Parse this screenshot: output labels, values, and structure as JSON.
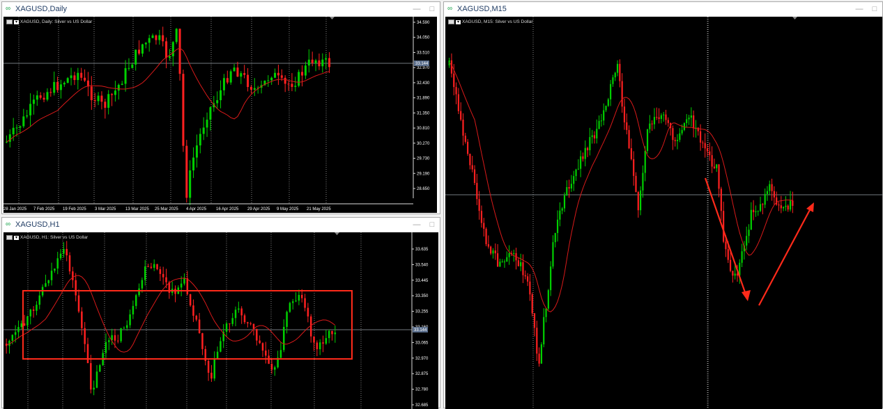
{
  "colors": {
    "bull": "#00d000",
    "bear": "#ff2020",
    "ma": "#d81a1a",
    "bg": "#000000",
    "grid": "#bbbbbb",
    "annotation": "#ff2a1a",
    "price_tag_bg": "#5a6e8c"
  },
  "windows": {
    "daily": {
      "title": "XAGUSD,Daily",
      "label": "XAGUSD, Daily:  Silver vs US Dollar",
      "price_levels": [
        "34.590",
        "34.050",
        "33.510",
        "32.970",
        "32.430",
        "31.890",
        "31.350",
        "30.810",
        "30.270",
        "29.730",
        "29.190",
        "28.650"
      ],
      "current_price": "33.144",
      "dates": [
        "28 Jan 2025",
        "7 Feb 2025",
        "19 Feb 2025",
        "3 Mar 2025",
        "13 Mar 2025",
        "25 Mar 2025",
        "4 Apr 2025",
        "16 Apr 2025",
        "29 Apr 2025",
        "9 May 2025",
        "21 May 2025"
      ]
    },
    "h1": {
      "title": "XAGUSD,H1",
      "label": "XAGUSD, H1:  Silver vs US Dollar",
      "price_levels": [
        "33.635",
        "33.540",
        "33.445",
        "33.350",
        "33.255",
        "33.160",
        "33.065",
        "32.970",
        "32.875",
        "32.780",
        "32.685"
      ],
      "current_price": "33.144"
    },
    "m15": {
      "title": "XAGUSD,M15",
      "label": "XAGUSD, M15:  Silver vs US Dollar"
    }
  },
  "icons": {
    "window": "chart-window-icon",
    "minimize": "minimize-icon",
    "maximize": "maximize-icon"
  }
}
